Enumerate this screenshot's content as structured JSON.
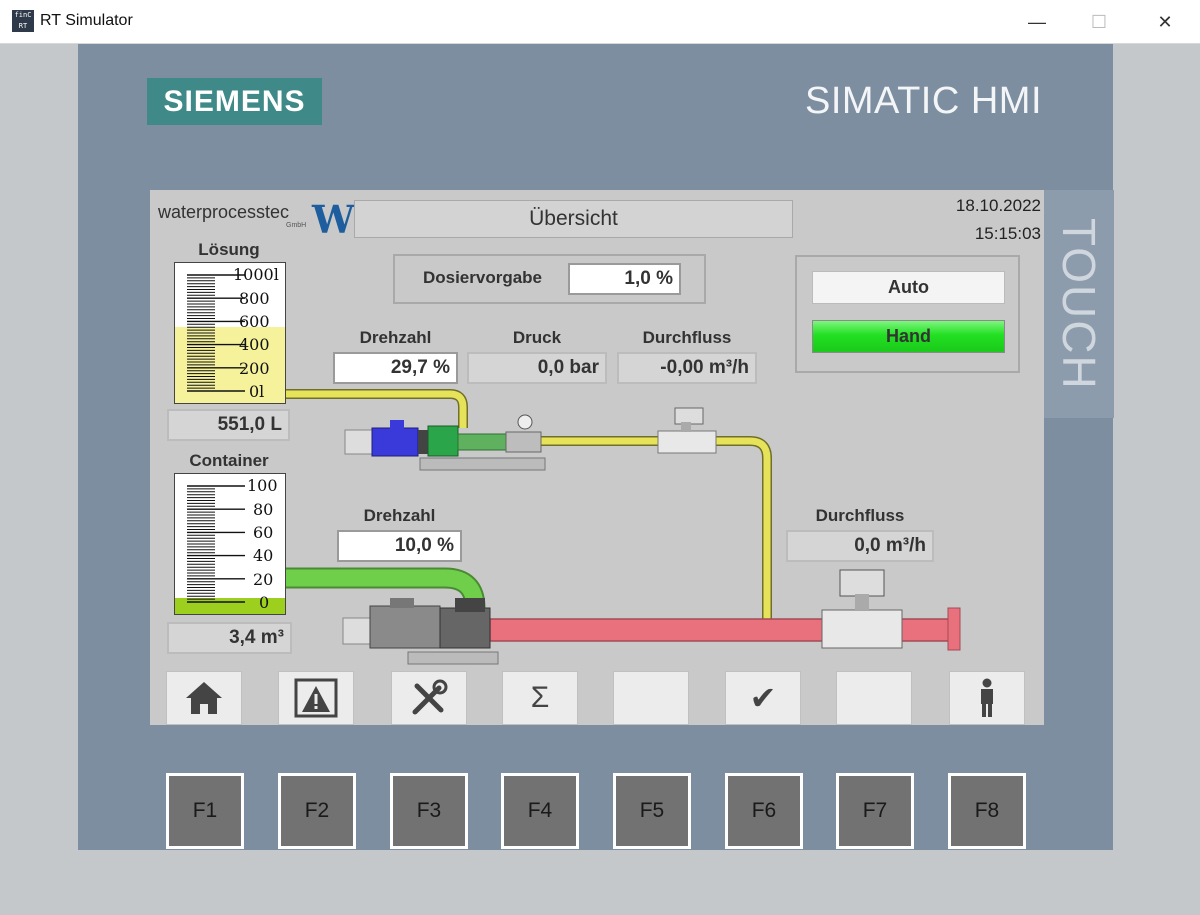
{
  "window": {
    "title": "RT Simulator",
    "icon_text": "finC RT",
    "minimize": "—",
    "maximize": "☐",
    "close": "✕"
  },
  "device": {
    "brand": "SIEMENS",
    "model": "SIMATIC HMI",
    "touch": "TOUCH"
  },
  "screen": {
    "logo_text": "waterprocesstec",
    "logo_mark": "W",
    "logo_sub": "GmbH",
    "title": "Übersicht",
    "date": "18.10.2022",
    "time": "15:15:03"
  },
  "loesung": {
    "label": "Lösung",
    "scale": [
      "1000l",
      "800",
      "600",
      "400",
      "200",
      "0l"
    ],
    "level_fraction": 0.551,
    "value": "551,0 L"
  },
  "container": {
    "label": "Container",
    "scale": [
      "100",
      "80",
      "60",
      "40",
      "20",
      "0"
    ],
    "level_fraction": 0.034,
    "value": "3,4 m³"
  },
  "dosiervorgabe": {
    "label": "Dosiervorgabe",
    "value": "1,0 %"
  },
  "pump1": {
    "drehzahl_label": "Drehzahl",
    "drehzahl": "29,7 %",
    "druck_label": "Druck",
    "druck": "0,0 bar",
    "durchfluss_label": "Durchfluss",
    "durchfluss": "-0,00 m³/h"
  },
  "pump2": {
    "drehzahl_label": "Drehzahl",
    "drehzahl": "10,0 %",
    "durchfluss_label": "Durchfluss",
    "durchfluss": "0,0 m³/h"
  },
  "mode": {
    "auto": "Auto",
    "hand": "Hand",
    "active": "Hand"
  },
  "nav": {
    "sigma": "Σ",
    "check": "✔"
  },
  "fkeys": [
    "F1",
    "F2",
    "F3",
    "F4",
    "F5",
    "F6",
    "F7",
    "F8"
  ],
  "colors": {
    "panel": "#7d8ea1",
    "brand": "#3f8a88",
    "yellow_pipe": "#e6e35a",
    "green_pipe": "#6fcf4a",
    "red_pipe": "#e9707d",
    "hand_active": "#2ee82e"
  }
}
